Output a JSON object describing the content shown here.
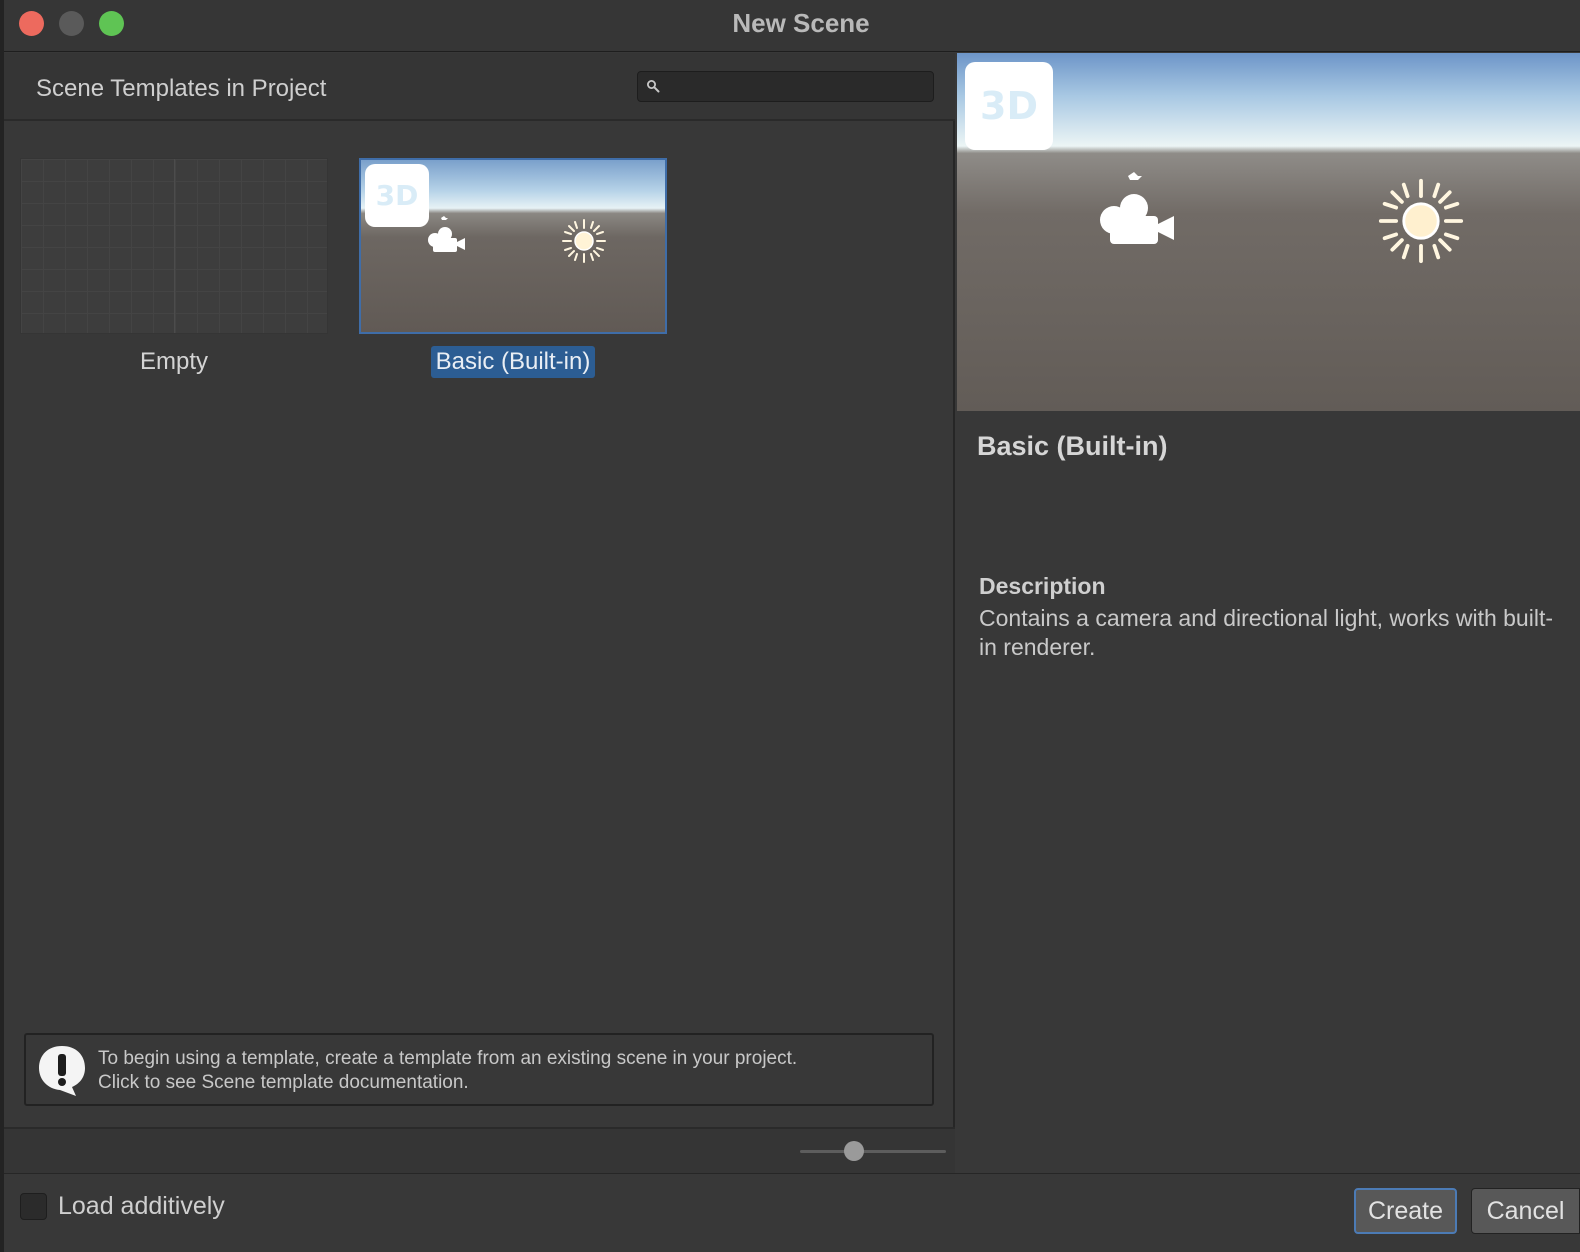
{
  "window": {
    "title": "New Scene"
  },
  "templates_panel": {
    "header": "Scene Templates in Project",
    "search": {
      "value": "",
      "placeholder": ""
    },
    "items": [
      {
        "label": "Empty",
        "selected": false
      },
      {
        "label": "Basic (Built-in)",
        "selected": true,
        "badge": "3D"
      }
    ],
    "info": {
      "line1": "To begin using a template, create a template from an existing scene in your project.",
      "line2": "Click to see Scene template documentation."
    },
    "size_slider": {
      "value": 0.37
    }
  },
  "details_panel": {
    "badge": "3D",
    "title": "Basic (Built-in)",
    "description_heading": "Description",
    "description": "Contains a camera and directional light, works with built-in renderer."
  },
  "footer": {
    "load_additively_label": "Load additively",
    "load_additively_checked": false,
    "create_label": "Create",
    "cancel_label": "Cancel"
  },
  "colors": {
    "selection": "#2c5d93",
    "accent_border": "#4c7bb5",
    "close": "#ed6a5e",
    "minimize": "#5a5a5a",
    "maximize": "#5fc454"
  },
  "icons": [
    "search-icon",
    "camera-gizmo-icon",
    "sun-light-icon",
    "warning-icon"
  ]
}
